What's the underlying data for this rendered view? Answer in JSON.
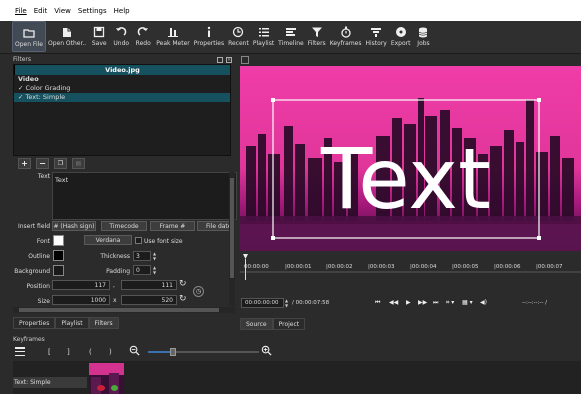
{
  "menu": [
    "File",
    "Edit",
    "View",
    "Settings",
    "Help"
  ],
  "toolbar": [
    {
      "label": "Open File",
      "icon": "open-file-icon"
    },
    {
      "label": "Open Other..",
      "icon": "open-other-icon"
    },
    {
      "label": "Save",
      "icon": "save-icon"
    },
    {
      "label": "Undo",
      "icon": "undo-icon"
    },
    {
      "label": "Redo",
      "icon": "redo-icon"
    },
    {
      "label": "Peak Meter",
      "icon": "peak-meter-icon"
    },
    {
      "label": "Properties",
      "icon": "properties-icon"
    },
    {
      "label": "Recent",
      "icon": "recent-icon"
    },
    {
      "label": "Playlist",
      "icon": "playlist-icon"
    },
    {
      "label": "Timeline",
      "icon": "timeline-icon"
    },
    {
      "label": "Filters",
      "icon": "filters-icon"
    },
    {
      "label": "Keyframes",
      "icon": "keyframes-icon"
    },
    {
      "label": "History",
      "icon": "history-icon"
    },
    {
      "label": "Export",
      "icon": "export-icon"
    },
    {
      "label": "Jobs",
      "icon": "jobs-icon"
    }
  ],
  "filters_panel": {
    "title": "Filters",
    "clip_name": "Video.jpg",
    "section": "Video",
    "items": [
      {
        "label": "Color Grading",
        "checked": true,
        "selected": false
      },
      {
        "label": "Text: Simple",
        "checked": true,
        "selected": true
      }
    ]
  },
  "props": {
    "text_label": "Text",
    "text_value": "Text",
    "insert_field_label": "Insert field",
    "hash_button": "# (Hash sign)",
    "timecode_button": "Timecode",
    "frame_button": "Frame #",
    "filedate_button": "File date",
    "font_label": "Font",
    "font_name": "Verdana",
    "use_font_size": "Use font size",
    "outline_label": "Outline",
    "thickness_label": "Thickness",
    "thickness_value": "3",
    "background_label": "Background",
    "padding_label": "Padding",
    "padding_value": "0",
    "position_label": "Position",
    "pos_x": "117",
    "pos_sep": ",",
    "pos_y": "111",
    "size_label": "Size",
    "size_w": "1000",
    "size_sep": "x",
    "size_h": "520",
    "font_color": "#ffffff",
    "outline_color": "#000000",
    "background_color": "#1a1a1a"
  },
  "left_tabs": [
    "Properties",
    "Playlist",
    "Filters"
  ],
  "viewer": {
    "overlay_text": "Text"
  },
  "ruler_labels": [
    "00:00:00",
    "|00:00:01",
    "|00:00:02",
    "|00:00:03",
    "|00:00:04",
    "|00:00:05",
    "|00:00:06",
    "|00:00:07"
  ],
  "transport": {
    "current": "00:00:00:00",
    "total": "/ 00:00:07:58",
    "in_out": "--:--:--:-- /"
  },
  "right_tabs": [
    "Source",
    "Project"
  ],
  "keyframes": {
    "title": "Keyframes",
    "track_label": "Text: Simple",
    "toolbar_glyphs": [
      "[",
      "]",
      "(",
      ")"
    ]
  }
}
